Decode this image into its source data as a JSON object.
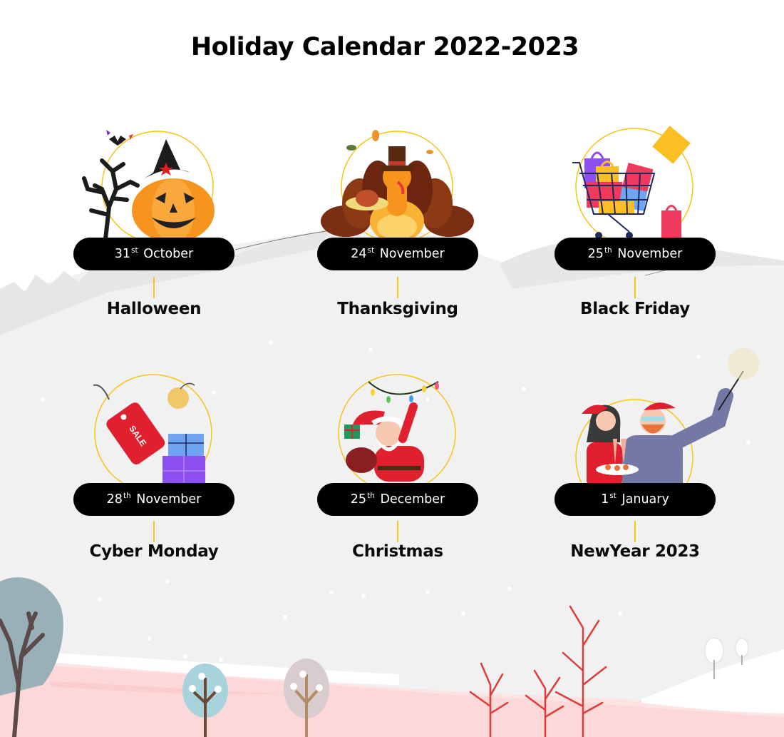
{
  "title": "Holiday Calendar 2022-2023",
  "colors": {
    "pill_bg": "#000000",
    "pill_text": "#ffffff",
    "accent_ring": "#f5c518",
    "background": "#f1f1f1",
    "ground_pink": "#fde0e0"
  },
  "holidays": [
    {
      "day": "31",
      "suffix": "st",
      "month": "October",
      "name": "Halloween",
      "icon": "jack-o-lantern-icon"
    },
    {
      "day": "24",
      "suffix": "st",
      "month": "November",
      "name": "Thanksgiving",
      "icon": "turkey-icon"
    },
    {
      "day": "25",
      "suffix": "th",
      "month": "November",
      "name": "Black Friday",
      "icon": "shopping-cart-icon"
    },
    {
      "day": "28",
      "suffix": "th",
      "month": "November",
      "name": "Cyber Monday",
      "icon": "sale-tag-icon"
    },
    {
      "day": "25",
      "suffix": "th",
      "month": "December",
      "name": "Christmas",
      "icon": "santa-claus-icon"
    },
    {
      "day": "1",
      "suffix": "st",
      "month": "January",
      "name": "NewYear 2023",
      "icon": "new-year-couple-icon"
    }
  ]
}
